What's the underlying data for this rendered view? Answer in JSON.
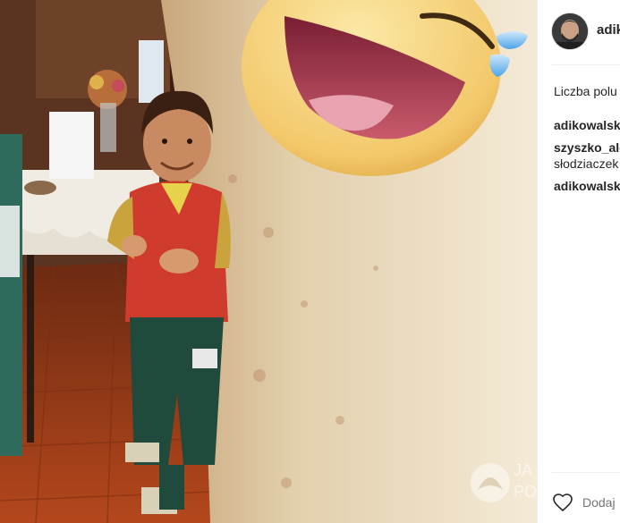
{
  "post": {
    "username": "adik",
    "likes_label": "Liczba polu",
    "comments": [
      {
        "author": "adikowalsk",
        "text": ""
      },
      {
        "author": "szyszko_ale",
        "text": "słodziaczek"
      },
      {
        "author": "adikowalsk",
        "text": ""
      }
    ],
    "add_comment_placeholder": "Dodaj"
  },
  "watermark": {
    "line1": "JA",
    "line2": "PO"
  },
  "icons": {
    "like": "heart-icon",
    "reaction": "laughing-emoji-icon",
    "watermark_logo": "watermark-logo-icon"
  }
}
